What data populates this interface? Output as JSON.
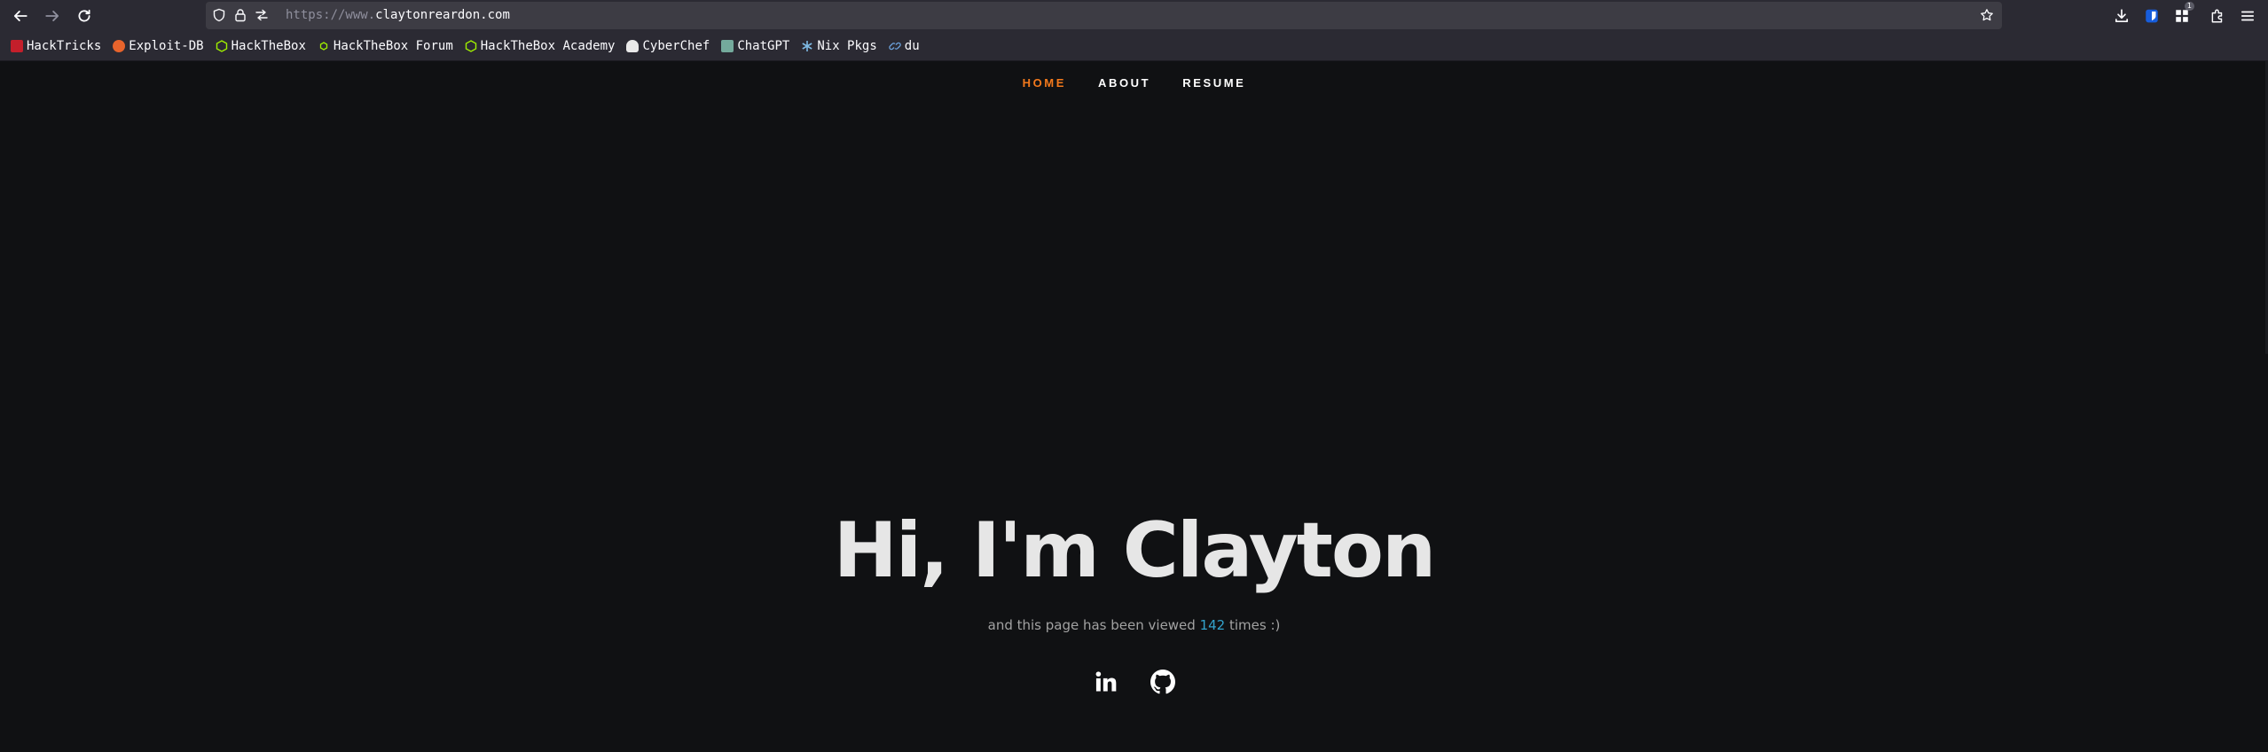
{
  "browser": {
    "url_prefix": "https://www.",
    "url_domain": "claytonreardon.com",
    "extension_badge": "1",
    "icons": {
      "back": "back-arrow-icon",
      "forward": "forward-arrow-icon",
      "reload": "reload-icon",
      "shield": "tracking-shield-icon",
      "lock": "lock-icon",
      "permissions": "permissions-icon",
      "bookmark_star": "star-icon",
      "downloads": "download-icon",
      "bitwarden": "bitwarden-icon",
      "extensions": "extensions-icon",
      "menu": "hamburger-menu-icon"
    }
  },
  "bookmarks": [
    {
      "label": "HackTricks",
      "color": "#c41f2b"
    },
    {
      "label": "Exploit-DB",
      "color": "#e8642c"
    },
    {
      "label": "HackTheBox",
      "color": "#9fef00"
    },
    {
      "label": "HackTheBox Forum",
      "color": "#9fef00"
    },
    {
      "label": "HackTheBox Academy",
      "color": "#9fef00"
    },
    {
      "label": "CyberChef",
      "color": "#e9e9e9"
    },
    {
      "label": "ChatGPT",
      "color": "#74aa9c"
    },
    {
      "label": "Nix Pkgs",
      "color": "#7ebae4"
    },
    {
      "label": "du",
      "color": "#6a9fd8"
    }
  ],
  "site": {
    "nav": [
      {
        "label": "HOME",
        "active": true
      },
      {
        "label": "ABOUT",
        "active": false
      },
      {
        "label": "RESUME",
        "active": false
      }
    ],
    "hero_title": "Hi, I'm Clayton",
    "subtitle_before": "and this page has been viewed ",
    "view_count": "142",
    "subtitle_after": " times :)",
    "social": [
      {
        "name": "linkedin-icon"
      },
      {
        "name": "github-icon"
      }
    ],
    "accent_color": "#f3791c",
    "count_color": "#33a3cc"
  }
}
